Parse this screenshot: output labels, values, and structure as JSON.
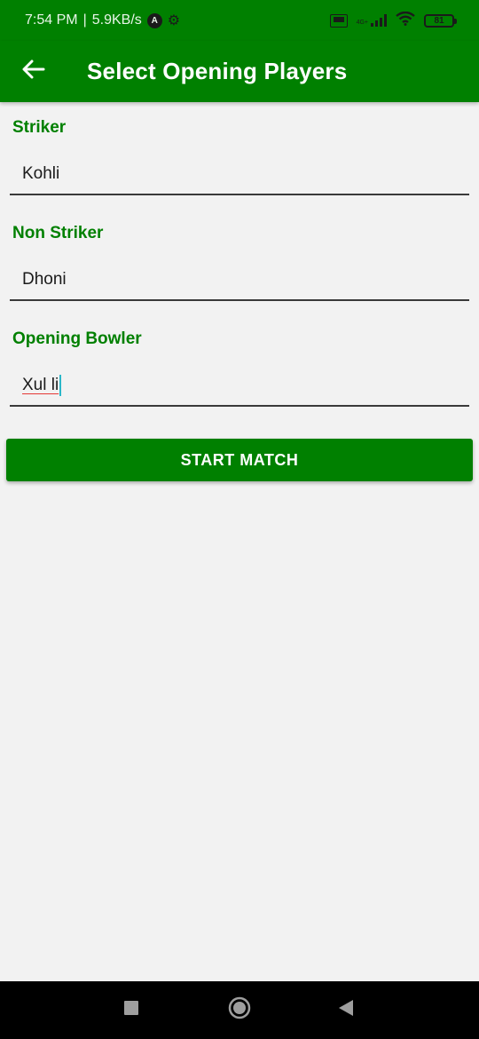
{
  "status_bar": {
    "time": "7:54 PM",
    "separator": "|",
    "speed": "5.9KB/s",
    "app_badge": "A",
    "network_label": "4G+",
    "volte_label": "VoLTE",
    "battery_level": "81"
  },
  "app_bar": {
    "title": "Select Opening Players",
    "back_icon": "arrow-left-icon"
  },
  "form": {
    "striker": {
      "label": "Striker",
      "value": "Kohli"
    },
    "non_striker": {
      "label": "Non Striker",
      "value": "Dhoni"
    },
    "bowler": {
      "label": "Opening Bowler",
      "value": "Xul li"
    }
  },
  "actions": {
    "start_label": "START MATCH"
  },
  "colors": {
    "primary": "#008000",
    "background": "#f2f2f2",
    "cursor": "#2bb7c9"
  },
  "nav_bar": {
    "recent_icon": "square-icon",
    "home_icon": "circle-icon",
    "back_icon": "triangle-back-icon"
  }
}
